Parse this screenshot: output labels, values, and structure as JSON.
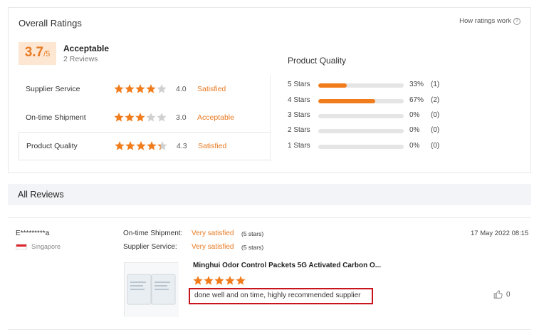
{
  "overall": {
    "title": "Overall Ratings",
    "how_link": "How ratings work",
    "help_icon": "?",
    "score": "3.7",
    "score_denominator": "/5",
    "level": "Acceptable",
    "reviews_count": "2 Reviews"
  },
  "sub_ratings": [
    {
      "label": "Supplier Service",
      "stars": 4.0,
      "score": "4.0",
      "level": "Satisfied"
    },
    {
      "label": "On-time Shipment",
      "stars": 3.0,
      "score": "3.0",
      "level": "Acceptable"
    },
    {
      "label": "Product Quality",
      "stars": 4.3,
      "score": "4.3",
      "level": "Satisfied",
      "selected": true
    }
  ],
  "product_quality": {
    "title": "Product Quality",
    "distribution": [
      {
        "label": "5 Stars",
        "percent": 33,
        "pct_text": "33%",
        "count": "(1)"
      },
      {
        "label": "4 Stars",
        "percent": 67,
        "pct_text": "67%",
        "count": "(2)"
      },
      {
        "label": "3 Stars",
        "percent": 0,
        "pct_text": "0%",
        "count": "(0)"
      },
      {
        "label": "2 Stars",
        "percent": 0,
        "pct_text": "0%",
        "count": "(0)"
      },
      {
        "label": "1 Stars",
        "percent": 0,
        "pct_text": "0%",
        "count": "(0)"
      }
    ]
  },
  "all_reviews": {
    "title": "All Reviews"
  },
  "review": {
    "reviewer": "E*********a",
    "country": "Singapore",
    "date": "17 May 2022 08:15",
    "shipment_label": "On-time Shipment:",
    "shipment_value": "Very satisfied",
    "shipment_stars": "(5 stars)",
    "service_label": "Supplier Service:",
    "service_value": "Very satisfied",
    "service_stars": "(5 stars)",
    "product_title": "Minghui Odor Control Packets 5G Activated Carbon O...",
    "product_stars": 5,
    "text": "done well and on time, highly recommended supplier",
    "likes": "0"
  },
  "colors": {
    "accent": "#e87920",
    "star": "#f07c1c",
    "star_empty": "#d0d0d0",
    "highlight_border": "#c8141d"
  }
}
